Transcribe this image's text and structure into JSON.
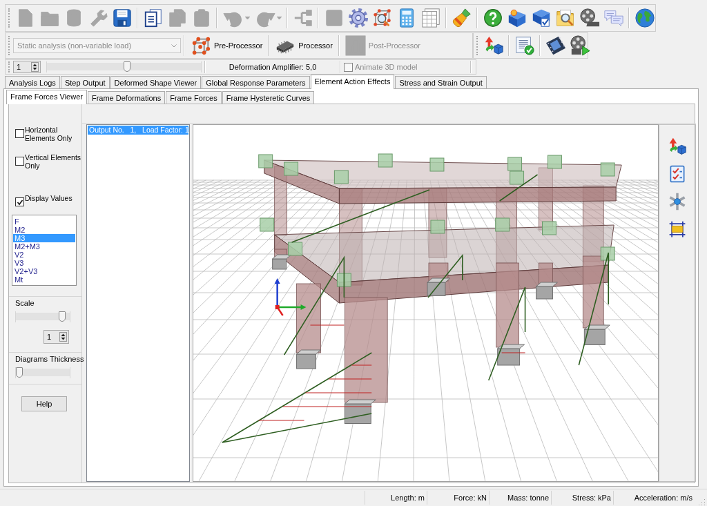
{
  "toolbar": {
    "groups": [
      [
        {
          "disabled": true
        },
        {
          "disabled": true
        },
        {
          "disabled": true
        },
        {
          "disabled": true
        },
        {
          "disabled": false
        }
      ],
      [
        {
          "disabled": false
        },
        {
          "disabled": true
        },
        {
          "disabled": true
        }
      ],
      [
        {
          "disabled": true
        },
        {
          "disabled": true
        }
      ],
      [
        {
          "disabled": true
        }
      ],
      [
        {
          "disabled": true
        },
        {
          "disabled": false
        },
        {
          "disabled": false
        },
        {
          "disabled": false
        },
        {
          "disabled": false
        }
      ],
      [
        {
          "disabled": false
        }
      ],
      [
        {
          "disabled": false
        },
        {
          "disabled": false
        },
        {
          "disabled": false
        },
        {
          "disabled": false
        },
        {
          "disabled": false
        },
        {
          "disabled": false
        }
      ],
      [
        {
          "disabled": false
        }
      ]
    ]
  },
  "analysis_type": {
    "value": "Static analysis (non-variable load)",
    "disabled": true
  },
  "processor_buttons": [
    {
      "label": "Pre-Processor",
      "disabled": false
    },
    {
      "label": "Processor",
      "disabled": false
    },
    {
      "label": "Post-Processor",
      "disabled": true
    }
  ],
  "toolbar_2": {
    "groups": [
      [
        {
          "disabled": false
        }
      ],
      [
        {
          "disabled": false
        }
      ],
      [
        {
          "disabled": false
        },
        {
          "disabled": false
        }
      ]
    ]
  },
  "step": {
    "value": "1"
  },
  "step_slider": {
    "level": 0.52
  },
  "deformation_amplifier": "Deformation Amplifier: 5,0",
  "animate": {
    "label": "Animate 3D model",
    "checked": false,
    "disabled": true
  },
  "tabs": [
    {
      "label": "Analysis Logs",
      "selected": false
    },
    {
      "label": "Step Output",
      "selected": false
    },
    {
      "label": "Deformed Shape Viewer",
      "selected": false
    },
    {
      "label": "Global Response Parameters",
      "selected": false
    },
    {
      "label": "Element Action Effects",
      "selected": true
    },
    {
      "label": "Stress and Strain Output",
      "selected": false
    }
  ],
  "subtabs": [
    {
      "label": "Frame Forces Viewer",
      "selected": true
    },
    {
      "label": "Frame Deformations",
      "selected": false
    },
    {
      "label": "Frame Forces",
      "selected": false
    },
    {
      "label": "Frame Hysteretic Curves",
      "selected": false
    }
  ],
  "filters": [
    {
      "label": "Horizontal Elements Only",
      "checked": false
    },
    {
      "label": "Vertical Elements Only",
      "checked": false
    },
    {
      "label": "Display Values",
      "checked": true
    }
  ],
  "components": [
    {
      "label": "F",
      "selected": false
    },
    {
      "label": "M2",
      "selected": false
    },
    {
      "label": "M3",
      "selected": true
    },
    {
      "label": "M2+M3",
      "selected": false
    },
    {
      "label": "V2",
      "selected": false
    },
    {
      "label": "V3",
      "selected": false
    },
    {
      "label": "V2+V3",
      "selected": false
    },
    {
      "label": "Mt",
      "selected": false
    }
  ],
  "scale": {
    "label": "Scale",
    "level": 0.88,
    "value": "1"
  },
  "thickness": {
    "label": "Diagrams Thickness",
    "level": 0
  },
  "help_button": "Help",
  "outputs": [
    {
      "label": "Output No.   1,   Load Factor: 1",
      "selected": true
    }
  ],
  "status_bar": [
    "Length: m",
    "Force: kN",
    "Mass: tonne",
    "Stress: kPa",
    "Acceleration: m/s"
  ]
}
